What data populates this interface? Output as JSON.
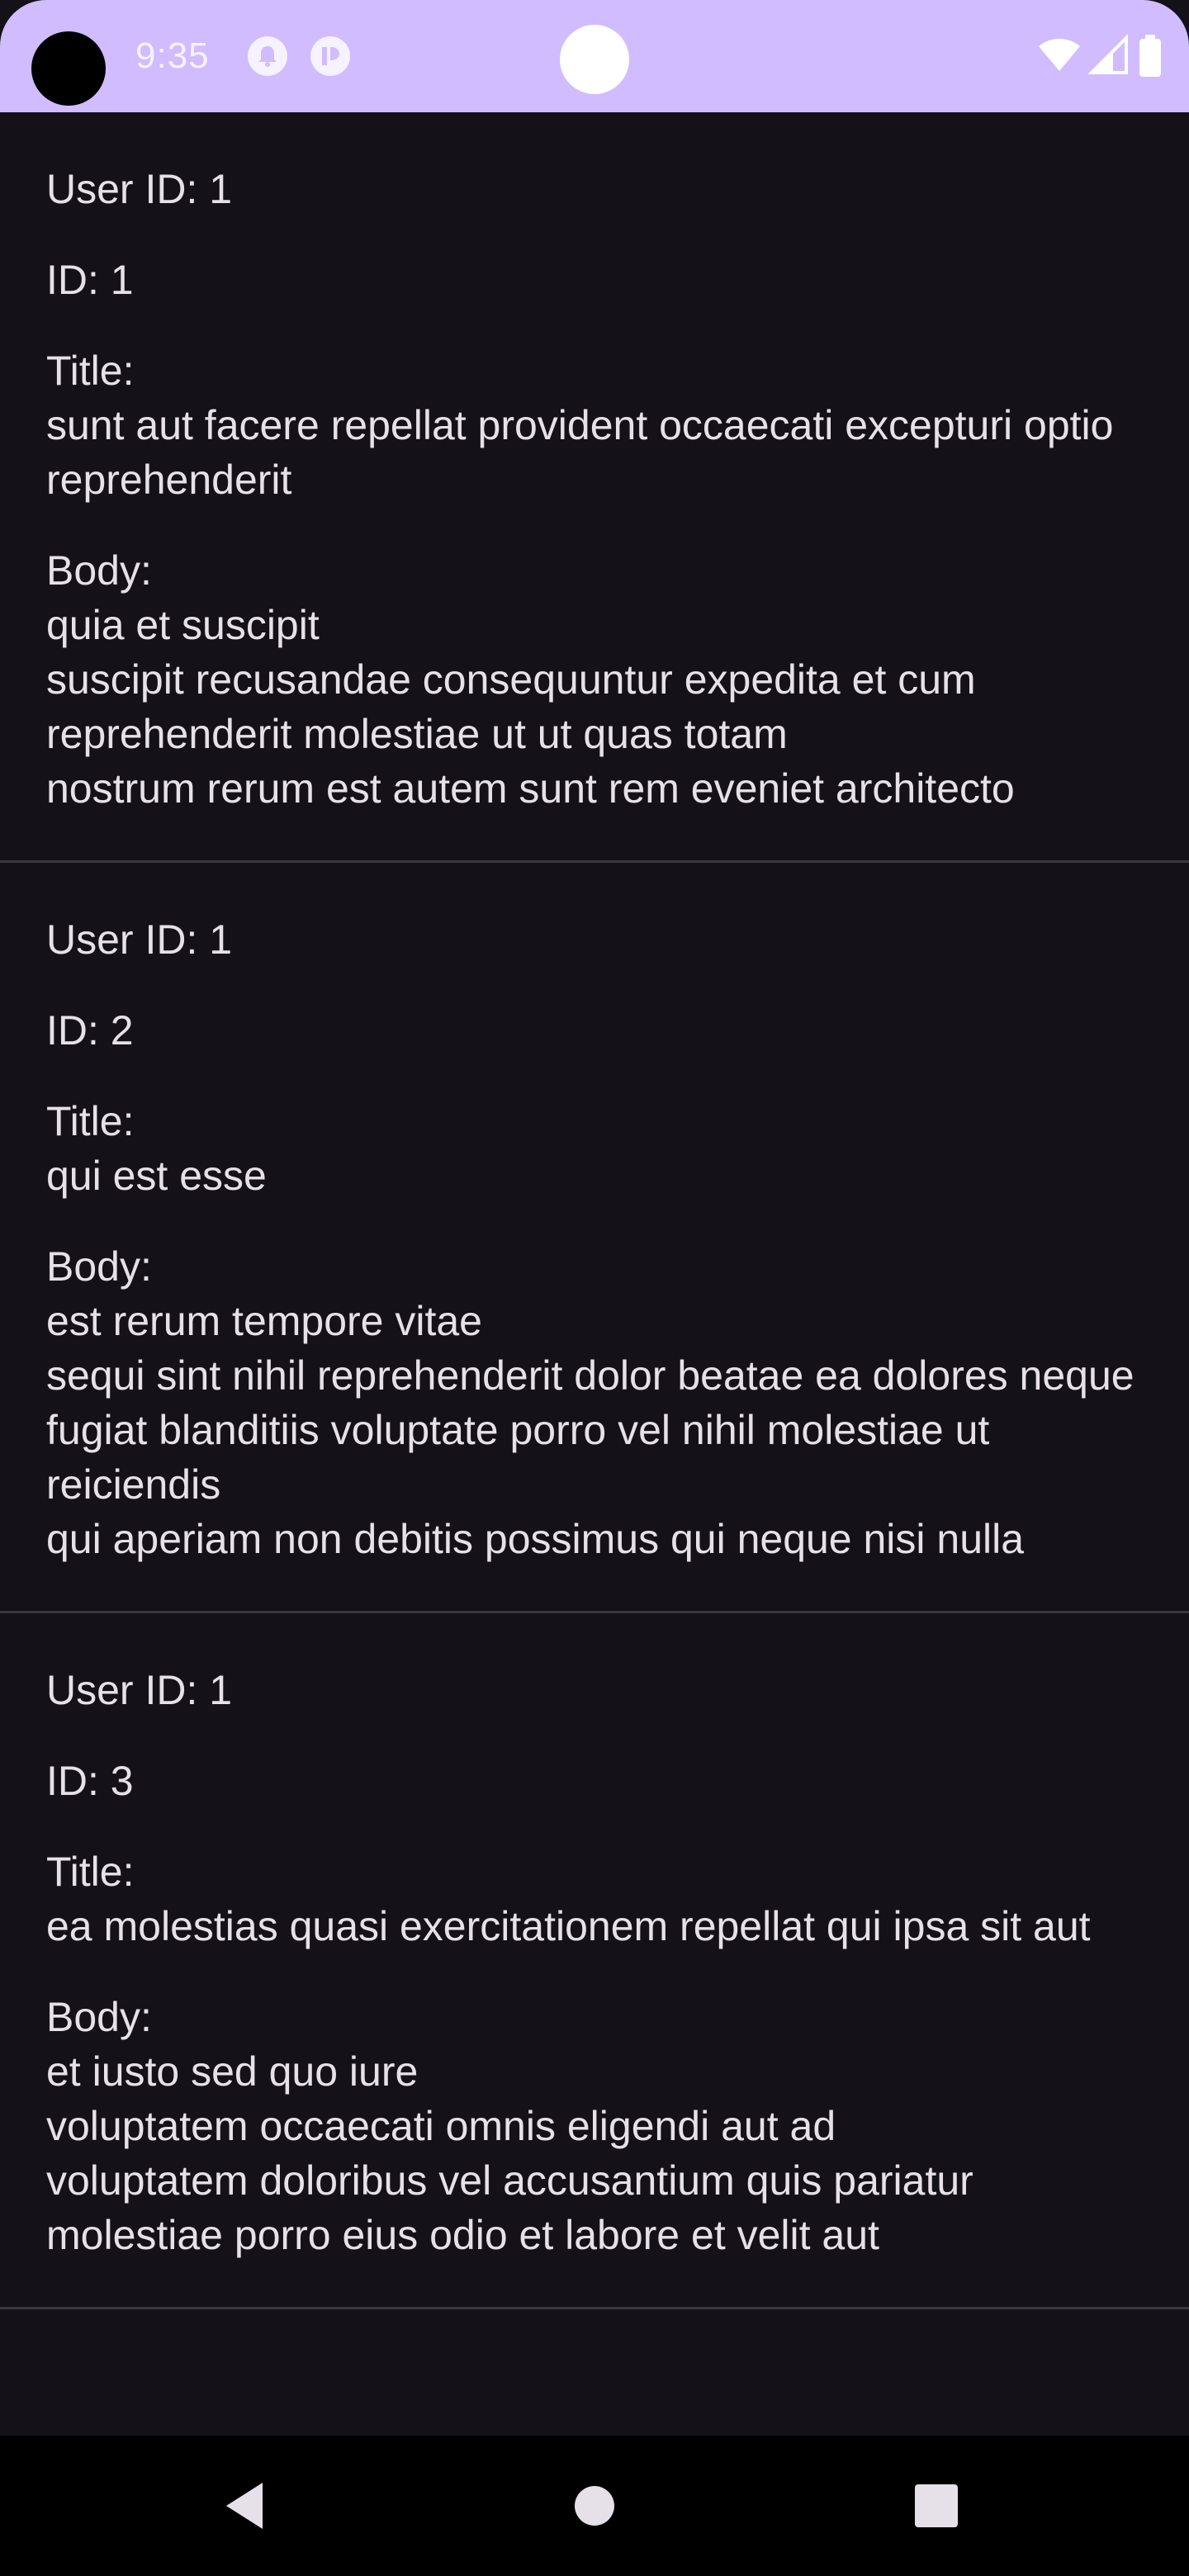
{
  "status_bar": {
    "time": "9:35",
    "icons": [
      "notification-icon",
      "app-icon",
      "wifi-icon",
      "signal-icon",
      "battery-icon"
    ]
  },
  "posts": [
    {
      "user_id": "User ID: 1",
      "id": "ID: 1",
      "title": "Title:\nsunt aut facere repellat provident occaecati excepturi optio reprehenderit",
      "body": "Body:\nquia et suscipit\nsuscipit recusandae consequuntur expedita et cum reprehenderit molestiae ut ut quas totam\nnostrum rerum est autem sunt rem eveniet architecto"
    },
    {
      "user_id": "User ID: 1",
      "id": "ID: 2",
      "title": "Title:\nqui est esse",
      "body": "Body:\nest rerum tempore vitae\nsequi sint nihil reprehenderit dolor beatae ea dolores neque\nfugiat blanditiis voluptate porro vel nihil molestiae ut reiciendis\nqui aperiam non debitis possimus qui neque nisi nulla"
    },
    {
      "user_id": "User ID: 1",
      "id": "ID: 3",
      "title": "Title:\nea molestias quasi exercitationem repellat qui ipsa sit aut",
      "body": "Body:\net iusto sed quo iure\nvoluptatem occaecati omnis eligendi aut ad\nvoluptatem doloribus vel accusantium quis pariatur\nmolestiae porro eius odio et labore et velit aut"
    }
  ],
  "nav_bar": {
    "icons": [
      "back-icon",
      "home-icon",
      "recents-icon"
    ]
  },
  "colors": {
    "status_bar": "#d0bcff",
    "background": "#141218",
    "text": "#e6e0e9",
    "divider": "#3a3740",
    "nav_bar": "#000000"
  }
}
